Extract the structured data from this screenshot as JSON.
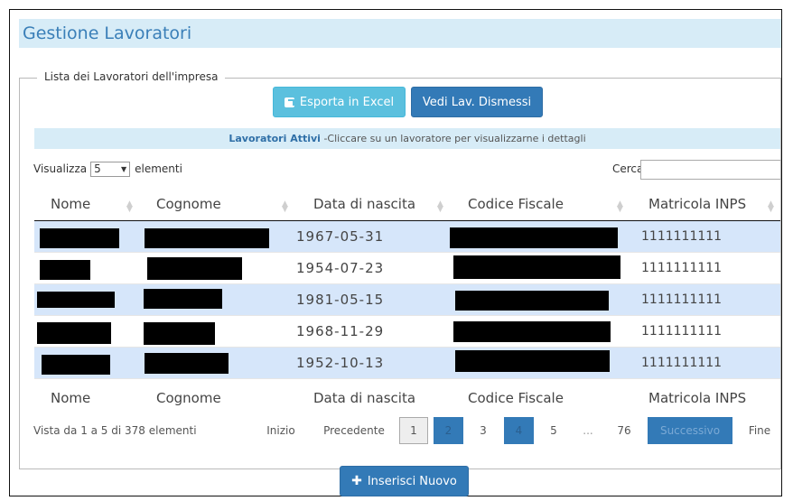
{
  "page": {
    "title": "Gestione Lavoratori"
  },
  "section": {
    "legend": "Lista dei Lavoratori dell'impresa"
  },
  "buttons": {
    "export": "Esporta in Excel",
    "dismissed": "Vedi Lav. Dismessi",
    "new": "Inserisci Nuovo"
  },
  "info_bar": {
    "strong": "Lavoratori Attivi",
    "text": " -Cliccare su un lavoratore per visualizzarne i dettagli"
  },
  "length": {
    "label_before": "Visualizza",
    "value": "5",
    "label_after": "elementi"
  },
  "search": {
    "label": "Cerca:",
    "value": ""
  },
  "columns": [
    "Nome",
    "Cognome",
    "Data di nascita",
    "Codice Fiscale",
    "Matricola INPS"
  ],
  "rows": [
    {
      "nome": "",
      "cognome": "",
      "data": "1967-05-31",
      "cf": "",
      "matricola": "1111111111"
    },
    {
      "nome": "",
      "cognome": "",
      "data": "1954-07-23",
      "cf": "",
      "matricola": "1111111111"
    },
    {
      "nome": "",
      "cognome": "",
      "data": "1981-05-15",
      "cf": "",
      "matricola": "1111111111"
    },
    {
      "nome": "",
      "cognome": "",
      "data": "1968-11-29",
      "cf": "",
      "matricola": "1111111111"
    },
    {
      "nome": "",
      "cognome": "",
      "data": "1952-10-13",
      "cf": "",
      "matricola": "1111111111"
    }
  ],
  "table_info": "Vista da 1 a 5 di 378 elementi",
  "pagination": {
    "first": "Inizio",
    "previous": "Precedente",
    "pages": [
      "1",
      "2",
      "3",
      "4",
      "5",
      "...",
      "76"
    ],
    "next": "Successivo",
    "last": "Fine",
    "current": "1"
  },
  "colors": {
    "title_bar": "#d7ecf7",
    "title_text": "#3a7fb8",
    "btn_info": "#5bc0de",
    "btn_primary": "#337ab7",
    "row_stripe": "#d6e6fa"
  },
  "icons": {
    "export": "external-link-icon",
    "new": "plus-icon",
    "sort": "sort-icon"
  }
}
